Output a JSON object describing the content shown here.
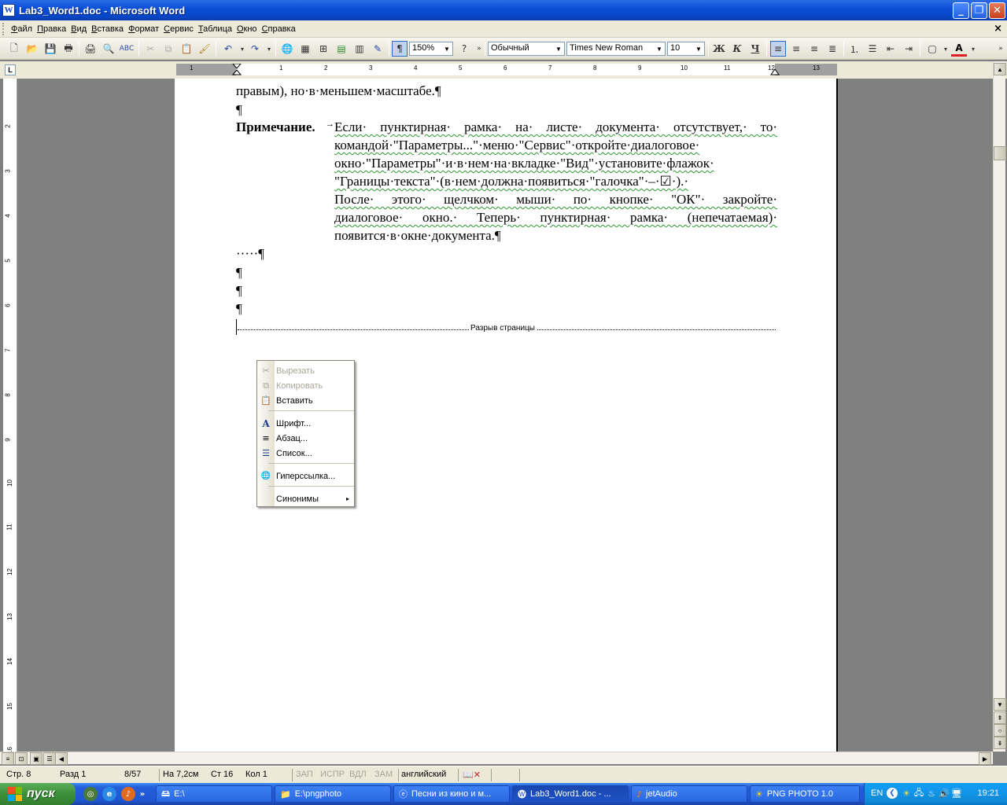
{
  "window": {
    "title": "Lab3_Word1.doc - Microsoft Word",
    "app_icon": "W",
    "buttons": [
      "minimize",
      "maximize",
      "close"
    ]
  },
  "menubar": {
    "items": [
      "Файл",
      "Правка",
      "Вид",
      "Вставка",
      "Формат",
      "Сервис",
      "Таблица",
      "Окно",
      "Справка"
    ],
    "close_glyph": "×"
  },
  "toolbar": {
    "zoom": "150%",
    "style": "Обычный",
    "font": "Times New Roman",
    "size": "10",
    "bold": "Ж",
    "italic": "К",
    "underline": "Ч",
    "pilcrow": "¶"
  },
  "ruler": {
    "corner": "L",
    "h_numbers": [
      "1",
      "1",
      "2",
      "3",
      "4",
      "5",
      "6",
      "7",
      "8",
      "9",
      "10",
      "11",
      "12",
      "13"
    ],
    "v_numbers": [
      "2",
      "3",
      "4",
      "5",
      "6",
      "7",
      "8",
      "9",
      "10",
      "11",
      "12",
      "13",
      "14",
      "15",
      "16"
    ]
  },
  "document": {
    "line_prev": "правым), но·в·меньшем·масштабе.¶",
    "pilcrow_1": "¶",
    "note_label": "Примечание.",
    "note_tab": "→",
    "note_lines": [
      "Если· пунктирная· рамка· на· листе· документа· отсутствует,· то·",
      "командой·\"Параметры...\"·меню·\"Сервис\"·откройте·диалоговое·",
      "окно·\"Параметры\"·и·в·нем·на·вкладке·\"Вид\"·установите·флажок·",
      "\"Границы·текста\"·(в·нем·должна·появиться·\"галочка\"·–·☑·).·",
      "После· этого· щелчком· мыши· по· кнопке· \"ОК\"· закройте·",
      "диалоговое· окно.· Теперь· пунктирная· рамка· (непечатаемая)·",
      "появится·в·окне·документа.¶"
    ],
    "dots_line": "·····¶",
    "empty_paragraphs": [
      "¶",
      "¶",
      "¶"
    ],
    "page_break_label": "Разрыв страницы"
  },
  "context_menu": {
    "items": [
      {
        "label": "Вырезать",
        "icon": "scissors-icon",
        "glyph": "✂",
        "enabled": false
      },
      {
        "label": "Копировать",
        "icon": "copy-icon",
        "glyph": "⧉",
        "enabled": false
      },
      {
        "label": "Вставить",
        "icon": "paste-icon",
        "glyph": "📋",
        "enabled": true
      },
      {
        "label": "Шрифт...",
        "icon": "font-icon",
        "glyph": "A",
        "enabled": true
      },
      {
        "label": "Абзац...",
        "icon": "paragraph-icon",
        "glyph": "≡",
        "enabled": true
      },
      {
        "label": "Список...",
        "icon": "list-icon",
        "glyph": "☰",
        "enabled": true
      },
      {
        "label": "Гиперссылка...",
        "icon": "hyperlink-icon",
        "glyph": "🌐",
        "enabled": true
      },
      {
        "label": "Синонимы",
        "icon": "",
        "glyph": "",
        "enabled": true,
        "submenu": "▸"
      }
    ]
  },
  "statusbar": {
    "page": "Стр. 8",
    "section": "Разд 1",
    "pages": "8/57",
    "at": "На 7,2см",
    "line": "Ст 16",
    "col": "Кол 1",
    "rec": "ЗАП",
    "trk": "ИСПР",
    "ext": "ВДЛ",
    "ovr": "ЗАМ",
    "language": "английский"
  },
  "taskbar": {
    "start": "пуск",
    "buttons": [
      {
        "label": "E:\\",
        "icon": "drive-icon"
      },
      {
        "label": "E:\\pngphoto",
        "icon": "folder-icon"
      },
      {
        "label": "Песни из кино и м...",
        "icon": "ie-icon"
      },
      {
        "label": "Lab3_Word1.doc - ...",
        "icon": "word-icon",
        "active": true
      },
      {
        "label": "jetAudio",
        "icon": "jetaudio-icon"
      },
      {
        "label": "PNG PHOTO 1.0",
        "icon": "pngphoto-icon"
      }
    ],
    "language": "EN",
    "clock": "19:21"
  },
  "colors": {
    "titlebar": "#0a4fd6",
    "taskbar": "#245edc",
    "start": "#3c8f3a",
    "squiggle": "#2e9b2e"
  }
}
